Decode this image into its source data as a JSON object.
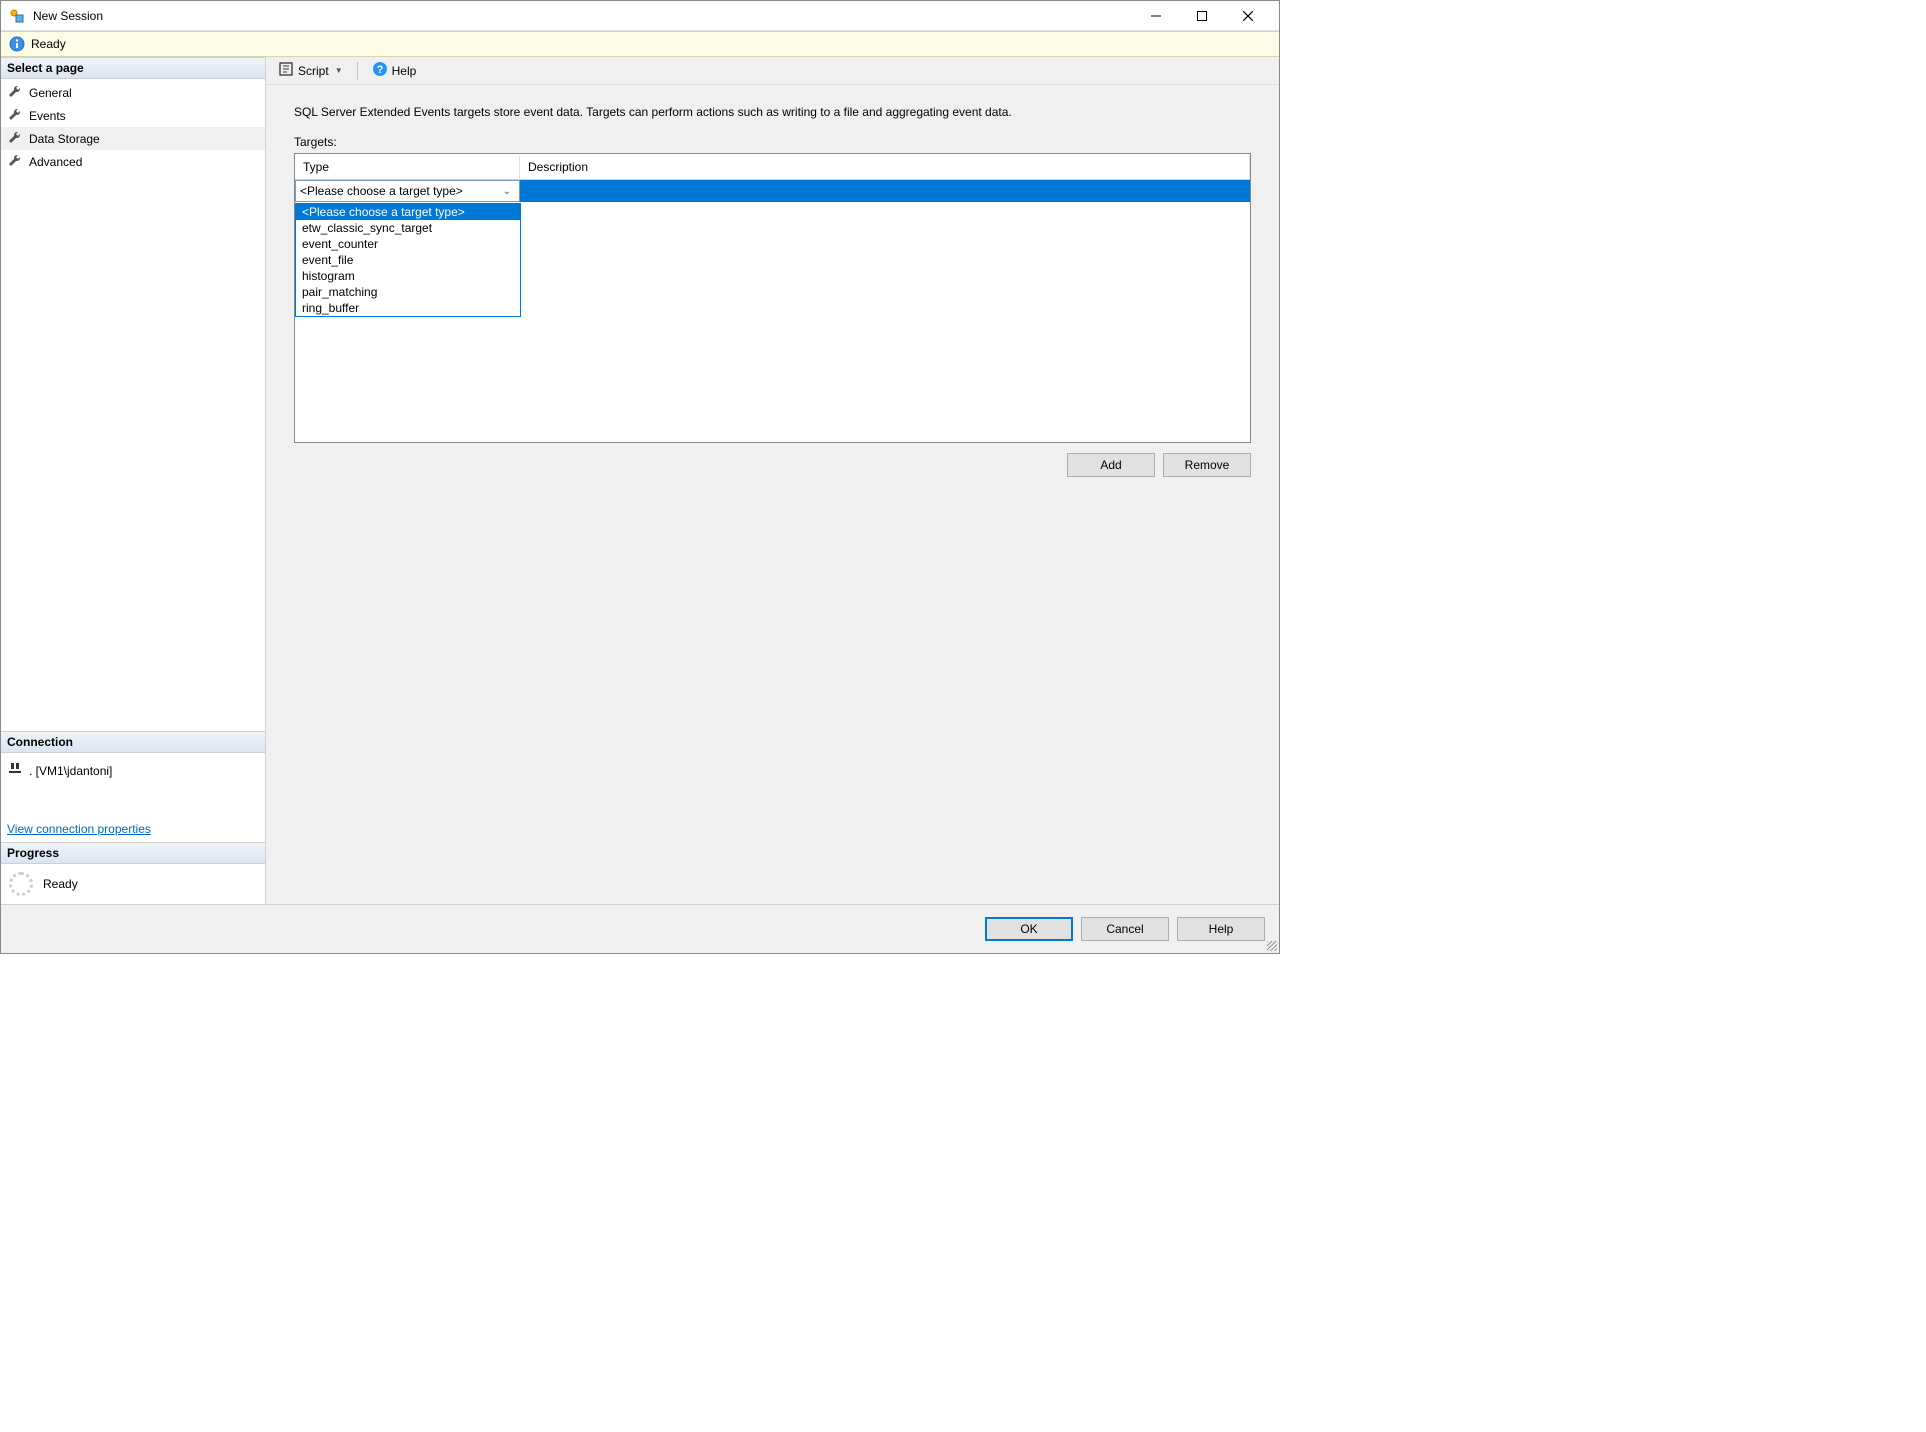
{
  "window": {
    "title": "New Session"
  },
  "status": {
    "text": "Ready"
  },
  "sidebar": {
    "select_page_header": "Select a page",
    "pages": [
      {
        "label": "General"
      },
      {
        "label": "Events"
      },
      {
        "label": "Data Storage"
      },
      {
        "label": "Advanced"
      }
    ],
    "connection_header": "Connection",
    "connection_text": ". [VM1\\jdantoni]",
    "view_connection_properties": "View connection properties",
    "progress_header": "Progress",
    "progress_text": "Ready"
  },
  "toolbar": {
    "script": "Script",
    "help": "Help"
  },
  "main": {
    "intro": "SQL Server Extended Events targets store event data. Targets can perform actions such as writing to a file and aggregating event data.",
    "targets_label": "Targets:",
    "columns": {
      "type": "Type",
      "description": "Description"
    },
    "dropdown_placeholder": "<Please choose a target type>",
    "dropdown_options": [
      "<Please choose a target type>",
      "etw_classic_sync_target",
      "event_counter",
      "event_file",
      "histogram",
      "pair_matching",
      "ring_buffer"
    ],
    "add_btn": "Add",
    "remove_btn": "Remove"
  },
  "footer": {
    "ok": "OK",
    "cancel": "Cancel",
    "help": "Help"
  }
}
